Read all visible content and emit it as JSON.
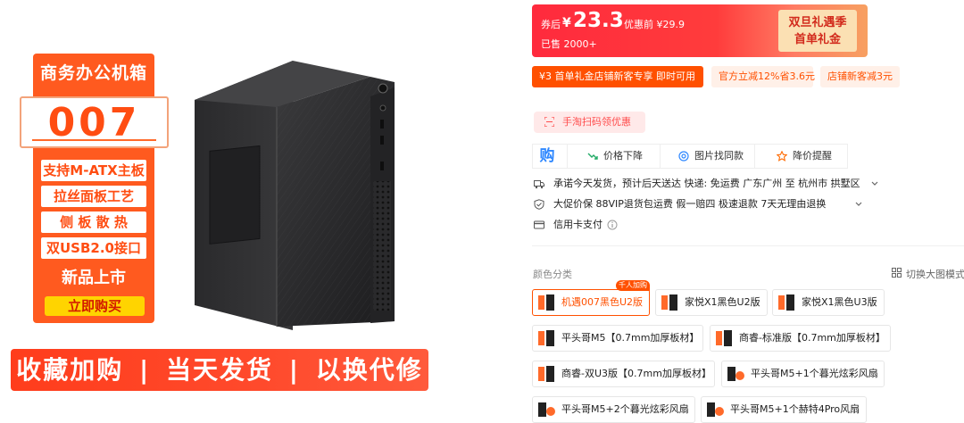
{
  "product_image": {
    "panel_title": "商务办公机箱",
    "model": "007",
    "features": [
      "支持M-ATX主板",
      "拉丝面板工艺",
      "侧 板 散 热",
      "双USB2.0接口"
    ],
    "new_label": "新品上市",
    "buy_label": "立即购买",
    "bottom_banner": [
      "收藏加购",
      "当天发货",
      "以换代修"
    ],
    "separator": "|"
  },
  "price": {
    "coupon_label": "券后",
    "currency": "¥",
    "current": "23.3",
    "original_label": "优惠前 ¥29.9",
    "sold": "已售 2000+",
    "event_line1": "双旦礼遇季",
    "event_line2": "首单礼金"
  },
  "promo_tags": [
    "¥3  首单礼金店铺新客专享 即时可用",
    "官方立减12%省3.6元",
    "店铺新客减3元"
  ],
  "scan_label": "手淘扫码领优惠",
  "toolbar": {
    "buy": "购",
    "items": [
      "价格下降",
      "图片找同款",
      "降价提醒"
    ]
  },
  "service": {
    "shipping": "承诺今天发货，预计后天送达   快递: 免运费   广东广州 至 杭州市 拱墅区",
    "guarantee": "大促价保   88VIP退货包运费   假一赔四   极速退款   7天无理由退换",
    "payment": "信用卡支付"
  },
  "variants": {
    "label": "颜色分类",
    "big_mode": "切换大图模式",
    "badge": "千人加购",
    "options": [
      "机遇007黑色U2版",
      "家悦X1黑色U2版",
      "家悦X1黑色U3版",
      "平头哥M5【0.7mm加厚板材】",
      "商睿-标准版【0.7mm加厚板材】",
      "商睿-双U3版【0.7mm加厚板材】",
      "平头哥M5+1个暮光炫彩风扇",
      "平头哥M5+2个暮光炫彩风扇",
      "平头哥M5+1个赫特4Pro风扇"
    ]
  },
  "colors": {
    "accent": "#ff5000",
    "banner": "#ff3d1c",
    "price_red": "#ff2a3d",
    "link_blue": "#2f88ff"
  }
}
